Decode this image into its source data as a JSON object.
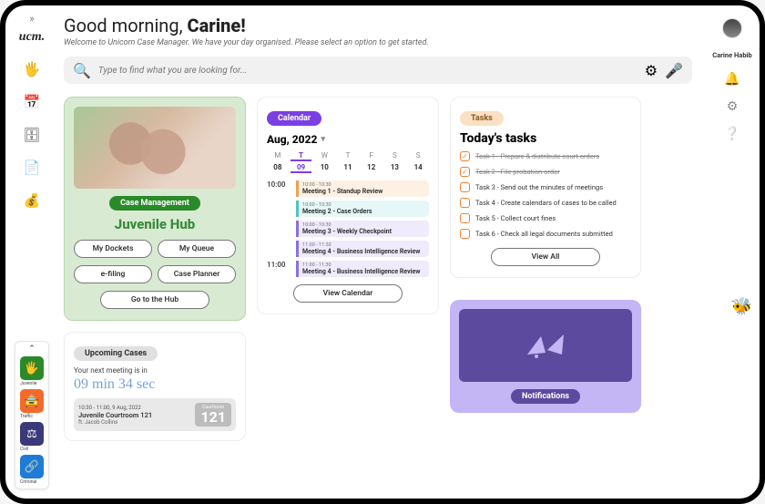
{
  "logo": "ucm.",
  "greeting": {
    "pre": "Good morning, ",
    "name": "Carine!"
  },
  "subtitle": "Welcome to Unicorn Case Manager. We have your day organised. Please select an option to get started.",
  "search": {
    "placeholder": "Type to find what you are looking for..."
  },
  "user": {
    "name": "Carine Habib"
  },
  "hubswitch": [
    {
      "label": "Juvenile",
      "color": "#2a8a2a",
      "icon": "🖐"
    },
    {
      "label": "Traffic",
      "color": "#f26b2b",
      "icon": "🚖"
    },
    {
      "label": "Civil",
      "color": "#3a3a7a",
      "icon": "⚖"
    },
    {
      "label": "Criminal",
      "color": "#1e7bd6",
      "icon": "🔗"
    }
  ],
  "case": {
    "badge": "Case Management",
    "title": "Juvenile Hub",
    "buttons": [
      "My Dockets",
      "My Queue",
      "e-filing",
      "Case Planner"
    ],
    "cta": "Go to the Hub"
  },
  "upcoming": {
    "badge": "Upcoming Cases",
    "lead": "Your next meeting is in",
    "timer": "09 min 34 sec",
    "time": "10:30 - 11:00, 9 Aug, 2022",
    "room": "Juvenile Courtroom 121",
    "person": "ft. Jacob Collins",
    "bigA": "Courtroom",
    "bigB": "121"
  },
  "calendar": {
    "badge": "Calendar",
    "month": "Aug, 2022",
    "days": [
      "M",
      "T",
      "W",
      "T",
      "F",
      "S",
      "S"
    ],
    "dates": [
      "08",
      "09",
      "10",
      "11",
      "12",
      "13",
      "14"
    ],
    "todayIdx": 1,
    "slots": [
      {
        "time": "10:00",
        "events": [
          {
            "t": "10:00 - 10:30",
            "n": "Meeting 1 - Standup Review",
            "c": "orange"
          },
          {
            "t": "10:00 - 10:30",
            "n": "Meeting 2 - Case Orders",
            "c": "teal"
          },
          {
            "t": "10:00 - 10:30",
            "n": "Meeting 3 - Weekly Checkpoint",
            "c": "purple"
          },
          {
            "t": "11:00 - 11:30",
            "n": "Meeting 4 - Business Intelligence Review",
            "c": "purple"
          }
        ]
      },
      {
        "time": "11:00",
        "events": [
          {
            "t": "11:00 - 11:30",
            "n": "Meeting 4 - Business Intelligence Review",
            "c": "purple"
          }
        ]
      }
    ],
    "cta": "View Calendar"
  },
  "tasks": {
    "badge": "Tasks",
    "title": "Today's tasks",
    "items": [
      {
        "done": true,
        "t": "Task 1 - Prepare & distribute court orders"
      },
      {
        "done": true,
        "t": "Task 2 - File probation order"
      },
      {
        "done": false,
        "t": "Task 3 - Send out the minutes of meetings"
      },
      {
        "done": false,
        "t": "Task 4 - Create calendars of cases to be called"
      },
      {
        "done": false,
        "t": "Task 5 - Collect court fines"
      },
      {
        "done": false,
        "t": "Task 6 - Check all legal documents submitted"
      }
    ],
    "cta": "View All"
  },
  "notif": {
    "badge": "Notifications"
  }
}
